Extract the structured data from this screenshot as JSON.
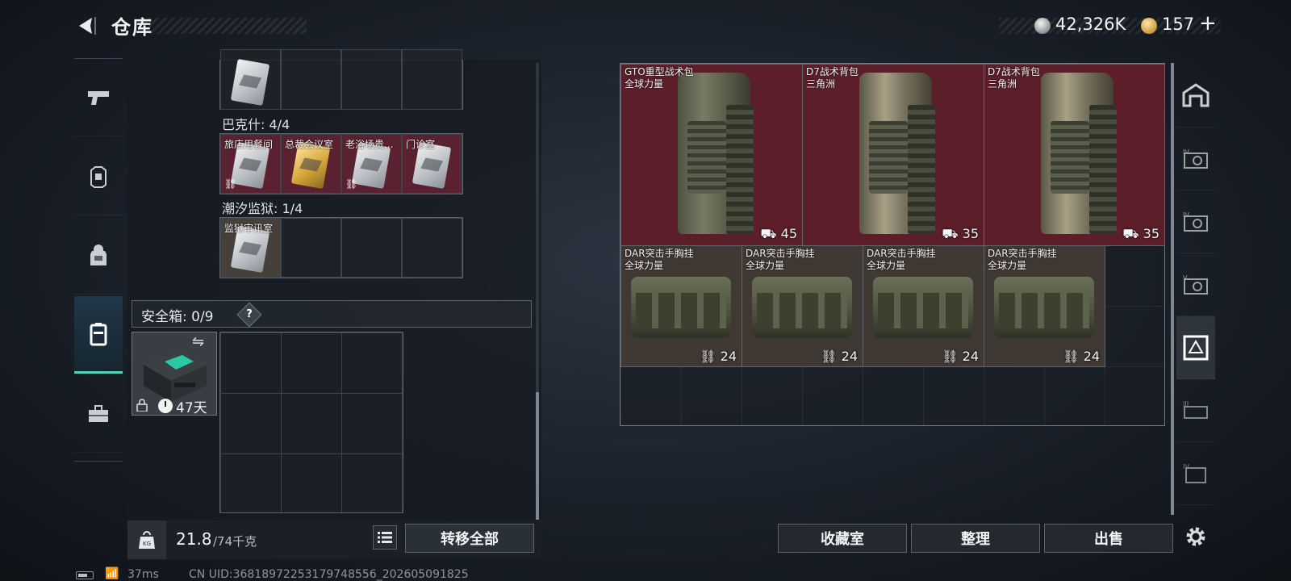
{
  "header": {
    "title": "仓库",
    "currency_value": "42,326K",
    "premium_value": "157",
    "plus_label": "+"
  },
  "left_nav": [
    "pistol-icon",
    "armor-icon",
    "backpack-icon",
    "case-icon",
    "toolbox-icon"
  ],
  "left_panel": {
    "groups": [
      {
        "label": "巴克什: 4/4",
        "cards": [
          {
            "name": "旅店用餐间",
            "color": "silver",
            "linked": true
          },
          {
            "name": "总裁会议室",
            "color": "gold",
            "linked": false
          },
          {
            "name": "老浴场贵...",
            "color": "silver",
            "linked": true
          },
          {
            "name": "门诊室",
            "color": "silver",
            "linked": false
          }
        ]
      },
      {
        "label": "潮汐监狱: 1/4",
        "cards": [
          {
            "name": "监狱审讯室",
            "color": "silver",
            "linked": false
          }
        ]
      }
    ],
    "safebox": {
      "label": "安全箱: 0/9",
      "help": "?",
      "swap_icon": "⇋",
      "days": "47天"
    },
    "weight": {
      "current": "21.8",
      "max": "/74千克"
    },
    "transfer_label": "转移全部"
  },
  "stash": {
    "backpacks": [
      {
        "name": "GTO重型战术包",
        "sub": "全球力量",
        "capacity": "45",
        "tone": "green"
      },
      {
        "name": "D7战术背包",
        "sub": "三角洲",
        "capacity": "35",
        "tone": "tan"
      },
      {
        "name": "D7战术背包",
        "sub": "三角洲",
        "capacity": "35",
        "tone": "tan"
      }
    ],
    "rigs": [
      {
        "name": "DAR突击手胸挂",
        "sub": "全球力量",
        "capacity": "24"
      },
      {
        "name": "DAR突击手胸挂",
        "sub": "全球力量",
        "capacity": "24"
      },
      {
        "name": "DAR突击手胸挂",
        "sub": "全球力量",
        "capacity": "24"
      },
      {
        "name": "DAR突击手胸挂",
        "sub": "全球力量",
        "capacity": "24"
      }
    ]
  },
  "buttons": {
    "collection": "收藏室",
    "sort": "整理",
    "sell": "出售"
  },
  "right_nav": [
    "home-icon",
    "case-iv-icon",
    "case-iv-2-icon",
    "case-v-icon",
    "case-active-icon",
    "case-iii-icon",
    "case-iv-3-icon",
    "gear-icon"
  ],
  "status": {
    "ping": "37ms",
    "uid": "CN UID:36818972253179748556_202605091825"
  },
  "colors": {
    "accent": "#4fd6b0",
    "item_red": "#5c1f2a",
    "item_brown": "#3f3833"
  }
}
